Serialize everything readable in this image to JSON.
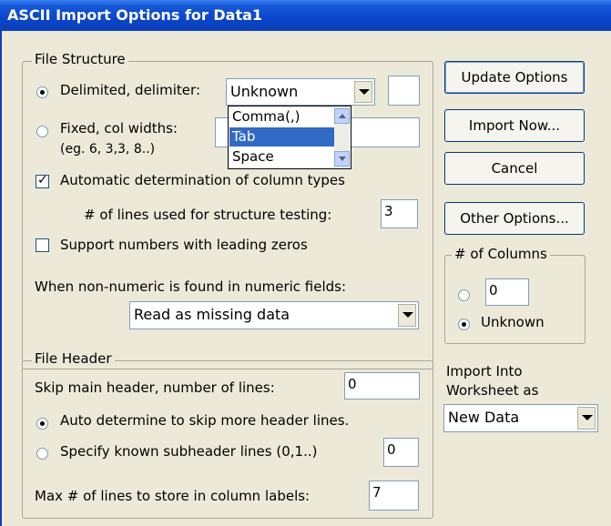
{
  "window": {
    "title": "ASCII Import Options for  Data1"
  },
  "file_structure": {
    "legend": "File Structure",
    "delimited_label": "Delimited, delimiter:",
    "delimiter_value": "Unknown",
    "delimiter_options": [
      "Comma(,)",
      "Tab",
      "Space"
    ],
    "delimiter_highlighted": "Tab",
    "fixed_label": "Fixed, col widths:",
    "fixed_hint": "(eg. 6, 3,3, 8..)",
    "auto_types_label": "Automatic determination of column types",
    "lines_testing_label": "# of lines used for structure testing:",
    "lines_testing_value": "3",
    "leading_zeros_label": "Support numbers with leading zeros",
    "non_numeric_label": "When non-numeric is found in numeric fields:",
    "non_numeric_value": "Read as missing data"
  },
  "file_header": {
    "legend": "File Header",
    "skip_main_label": "Skip main header, number of lines:",
    "skip_main_value": "0",
    "auto_skip_label": "Auto determine to skip more header lines.",
    "specify_label": "Specify known subheader lines (0,1..)",
    "specify_value": "0",
    "max_lines_label": "Max # of lines to store in column labels:",
    "max_lines_value": "7"
  },
  "buttons": {
    "update": "Update Options",
    "import_now": "Import Now...",
    "cancel": "Cancel",
    "other": "Other Options..."
  },
  "columns": {
    "legend": "# of Columns",
    "count_value": "0",
    "unknown_label": "Unknown"
  },
  "import_into": {
    "label_line1": "Import Into",
    "label_line2": "Worksheet as",
    "value": "New Data"
  }
}
